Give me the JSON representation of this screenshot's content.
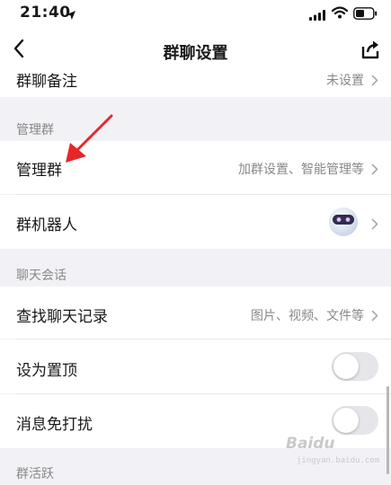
{
  "status_bar": {
    "time": "21:40",
    "location_icon": "location-arrow-icon",
    "signal_icon": "cellular-signal-icon",
    "wifi_icon": "wifi-icon",
    "battery_icon": "battery-icon"
  },
  "nav": {
    "back_icon": "chevron-left-icon",
    "title": "群聊设置",
    "share_icon": "share-icon"
  },
  "rows": {
    "remark": {
      "label": "群聊备注",
      "value": "未设置"
    },
    "manage": {
      "label": "管理群",
      "value": "加群设置、智能管理等"
    },
    "robot": {
      "label": "群机器人",
      "avatar_icon": "robot-avatar-icon"
    },
    "history": {
      "label": "查找聊天记录",
      "value": "图片、视频、文件等"
    },
    "pin": {
      "label": "设为置顶",
      "checked": false
    },
    "mute": {
      "label": "消息免打扰",
      "checked": false
    }
  },
  "sections": {
    "manage": "管理群",
    "chat": "聊天会话",
    "activity": "群活跃"
  },
  "watermark": {
    "brand": "Baidu",
    "site": "jingyan.baidu.com"
  },
  "colors": {
    "accent_arrow": "#e8262a",
    "page_bg": "#f2f2f6",
    "toggle_off": "#e5e5ea"
  }
}
